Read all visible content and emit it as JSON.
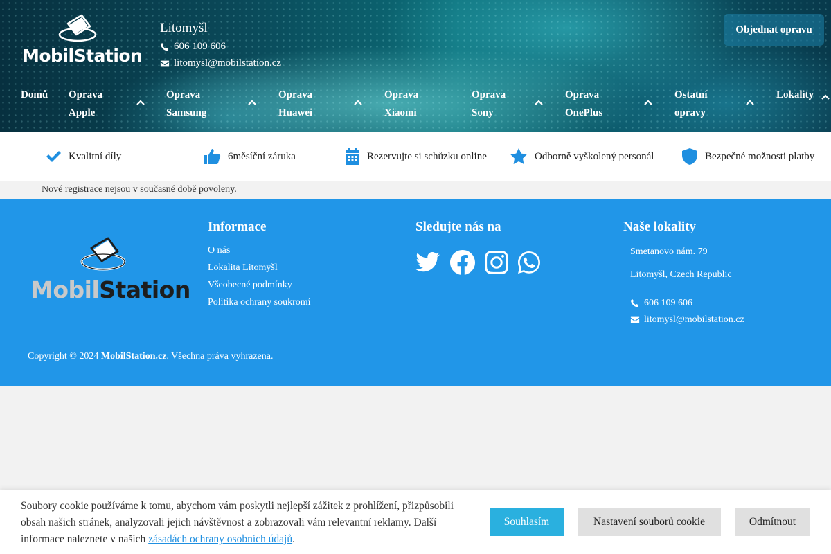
{
  "header": {
    "logo_text": "MobilStation",
    "city": "Litomyšl",
    "phone": "606 109 606",
    "email": "litomysl@mobilstation.cz",
    "order_button": "Objednat opravu"
  },
  "nav": [
    {
      "line1": "Domů",
      "line2": ""
    },
    {
      "line1": "Oprava",
      "line2": "Apple"
    },
    {
      "line1": "Oprava",
      "line2": "Samsung"
    },
    {
      "line1": "Oprava",
      "line2": "Huawei"
    },
    {
      "line1": "Oprava",
      "line2": "Xiaomi"
    },
    {
      "line1": "Oprava",
      "line2": "Sony"
    },
    {
      "line1": "Oprava",
      "line2": "OnePlus"
    },
    {
      "line1": "Ostatní",
      "line2": "opravy"
    },
    {
      "line1": "Lokality",
      "line2": ""
    }
  ],
  "features": [
    "Kvalitní díly",
    "6měsíční záruka",
    "Rezervujte si schůzku online",
    "Odborně vyškolený personál",
    "Bezpečné možnosti platby"
  ],
  "notice": "Nové registrace nejsou v současné době povoleny.",
  "footer": {
    "logo_text_a": "Mobil",
    "logo_text_b": "Station",
    "info_title": "Informace",
    "info_links": [
      "O nás",
      "Lokalita Litomyšl",
      "Všeobecné podmínky",
      "Politika ochrany soukromí"
    ],
    "social_title": "Sledujte nás na",
    "social_icons": [
      "twitter-icon",
      "facebook-icon",
      "instagram-icon",
      "whatsapp-icon"
    ],
    "locations_title": "Naše lokality",
    "address_line1": "Smetanovo nám. 79",
    "address_line2": "Litomyšl, Czech Republic",
    "phone": "606 109 606",
    "email": "litomysl@mobilstation.cz",
    "copyright_pre": "Copyright © 2024 ",
    "copyright_brand": "MobilStation.cz",
    "copyright_post": ". Všechna práva vyhrazena."
  },
  "cookie": {
    "text": "Soubory cookie používáme k tomu, abychom vám poskytli nejlepší zážitek z prohlížení, přizpůsobili obsah našich stránek, analyzovali jejich návštěvnost a zobrazovali vám relevantní reklamy. Další informace naleznete v našich ",
    "link": "zásadách ochrany osobních údajů",
    "text_end": ".",
    "accept": "Souhlasím",
    "settings": "Nastavení souborů cookie",
    "reject": "Odmítnout"
  },
  "colors": {
    "accent": "#2196e8",
    "icon_blue": "#1f8fe0",
    "accept_button": "#2ab0df"
  }
}
